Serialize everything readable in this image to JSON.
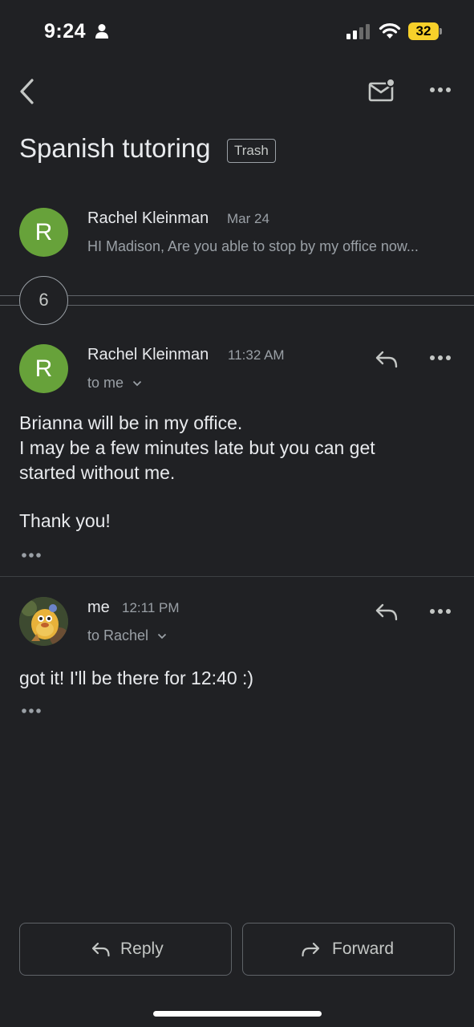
{
  "status_bar": {
    "time": "9:24",
    "battery_level": "32"
  },
  "thread": {
    "subject": "Spanish tutoring",
    "label": "Trash",
    "collapsed_count": "6"
  },
  "messages": [
    {
      "sender": "Rachel Kleinman",
      "avatar_letter": "R",
      "date": "Mar 24",
      "snippet": "HI Madison, Are you able to stop by my office now..."
    },
    {
      "sender": "Rachel Kleinman",
      "avatar_letter": "R",
      "time": "11:32 AM",
      "recipient": "to me",
      "body": [
        "Brianna will be in my office.",
        "I may be a few minutes late but you can get",
        "started without me.",
        "",
        "Thank you!"
      ]
    },
    {
      "sender": "me",
      "time": "12:11 PM",
      "recipient": "to Rachel",
      "body": [
        "got it! I'll be there for 12:40 :)"
      ]
    }
  ],
  "actions": {
    "reply_label": "Reply",
    "forward_label": "Forward"
  },
  "colors": {
    "background": "#202124",
    "avatar_green": "#67a23a",
    "battery": "#f7d02a"
  },
  "icons": [
    "back-icon",
    "mail-unread-icon",
    "more-icon",
    "reply-icon",
    "forward-icon",
    "person-icon",
    "signal-icon",
    "wifi-icon",
    "chevron-down-icon"
  ]
}
